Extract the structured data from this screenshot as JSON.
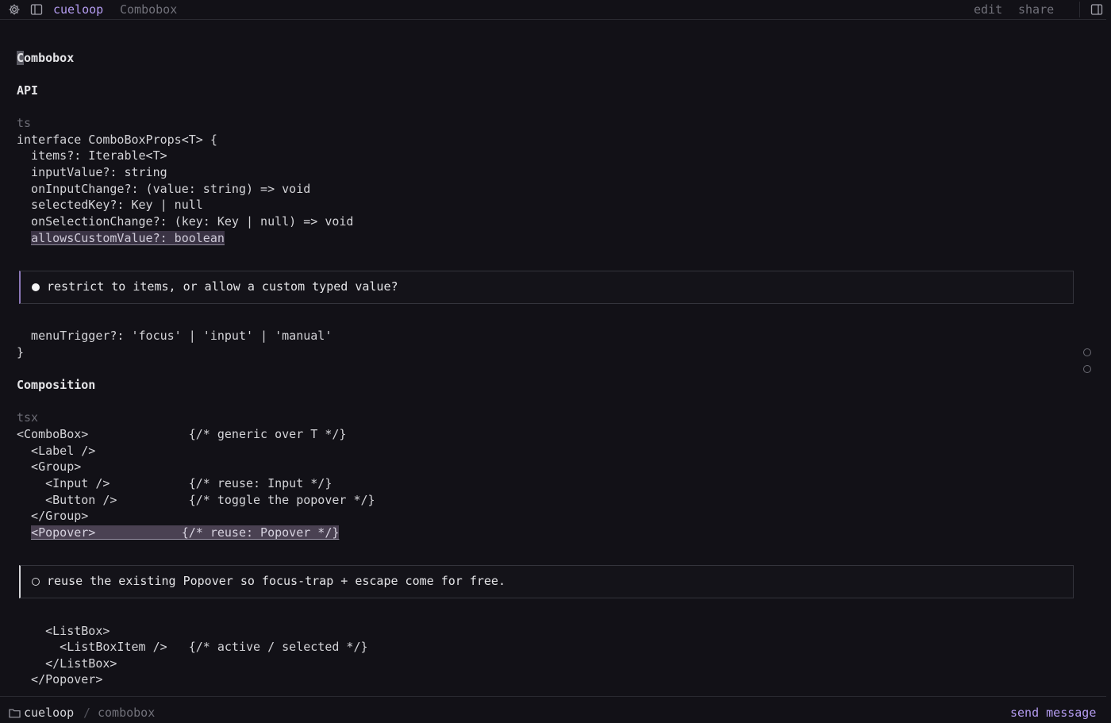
{
  "header": {
    "brand": "cueloop",
    "crumb": "Combobox",
    "edit_label": "edit",
    "share_label": "share"
  },
  "doc": {
    "title_first_char": "C",
    "title_rest": "ombobox",
    "api_heading": "API",
    "api_lang": "ts",
    "api_lines": [
      "interface ComboBoxProps<T> {",
      "  items?: Iterable<T>",
      "  inputValue?: string",
      "  onInputChange?: (value: string) => void",
      "  selectedKey?: Key | null",
      "  onSelectionChange?: (key: Key | null) => void"
    ],
    "api_highlight_indent": "  ",
    "api_highlight": "allowsCustomValue?: boolean",
    "note1": "restrict to items, or allow a custom typed value?",
    "api_lines_after": [
      "  menuTrigger?: 'focus' | 'input' | 'manual'",
      "}"
    ],
    "comp_heading": "Composition",
    "comp_lang": "tsx",
    "comp_lines": [
      "<ComboBox>              {/* generic over T */}",
      "  <Label />",
      "  <Group>",
      "    <Input />           {/* reuse: Input */}",
      "    <Button />          {/* toggle the popover */}",
      "  </Group>"
    ],
    "comp_highlight_indent": "  ",
    "comp_highlight": "<Popover>            {/* reuse: Popover */}",
    "note2": "reuse the existing Popover so focus-trap + escape come for free.",
    "comp_lines_after": [
      "    <ListBox>",
      "      <ListBoxItem />   {/* active / selected */}",
      "    </ListBox>",
      "  </Popover>"
    ]
  },
  "footer": {
    "name": "cueloop",
    "slash": "/",
    "crumb": "combobox",
    "send_label": "send message"
  },
  "icons": {
    "settings": "gear-icon",
    "sidebar": "sidebar-toggle-icon",
    "panel": "panel-right-icon",
    "folder": "folder-icon"
  },
  "colors": {
    "accent": "#b49cf0",
    "background": "#121117"
  }
}
